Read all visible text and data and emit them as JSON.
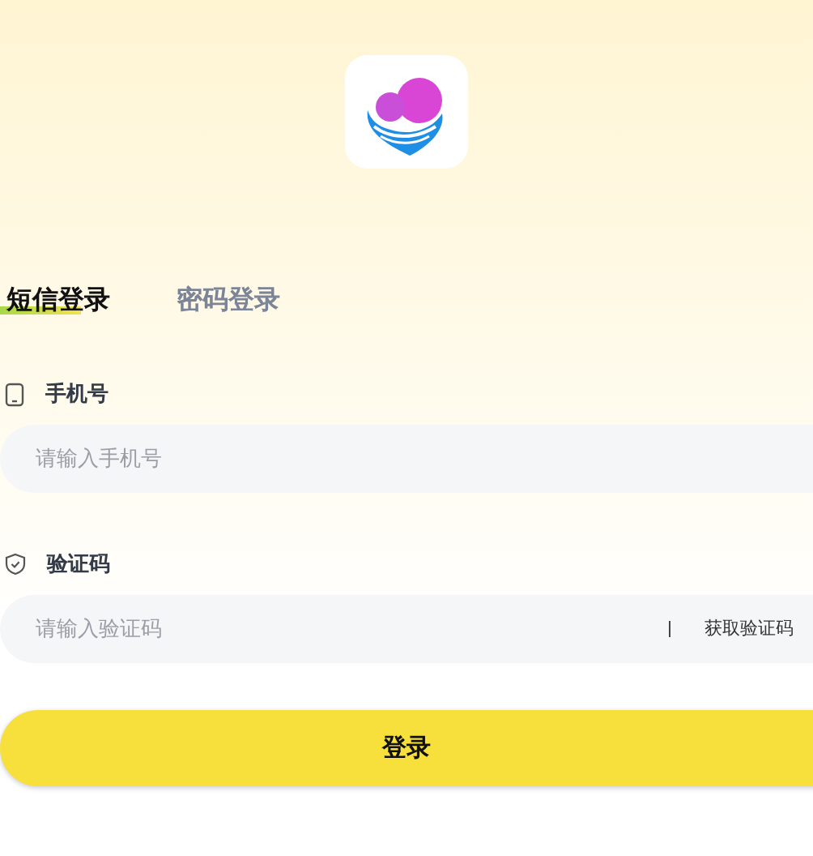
{
  "tabs": [
    {
      "label": "短信登录",
      "selected": true
    },
    {
      "label": "密码登录",
      "selected": false
    }
  ],
  "fields": [
    {
      "kind": "phone",
      "label": "手机号",
      "placeholder": "请输入手机号"
    },
    {
      "kind": "code",
      "label": "验证码",
      "placeholder": "请输入验证码",
      "action": "获取验证码"
    }
  ],
  "submit": "登录"
}
